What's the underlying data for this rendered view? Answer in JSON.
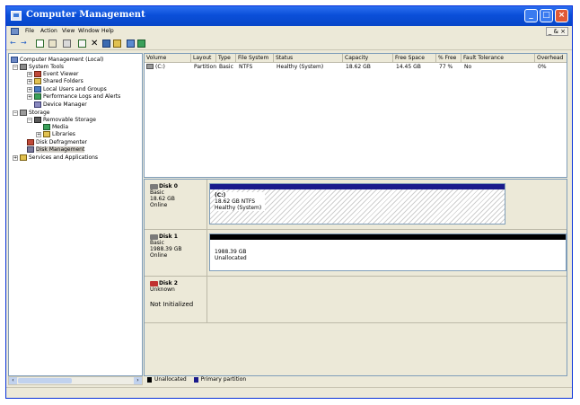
{
  "window": {
    "title": "Computer Management"
  },
  "menu": [
    {
      "label": "File"
    },
    {
      "label": "Action"
    },
    {
      "label": "View"
    },
    {
      "label": "Window"
    },
    {
      "label": "Help"
    }
  ],
  "mdi_controls": "_ & ×",
  "tree": [
    {
      "label": "Computer Management (Local)"
    },
    {
      "label": "System Tools"
    },
    {
      "label": "Event Viewer"
    },
    {
      "label": "Shared Folders"
    },
    {
      "label": "Local Users and Groups"
    },
    {
      "label": "Performance Logs and Alerts"
    },
    {
      "label": "Device Manager"
    },
    {
      "label": "Storage"
    },
    {
      "label": "Removable Storage"
    },
    {
      "label": "Media"
    },
    {
      "label": "Libraries"
    },
    {
      "label": "Disk Defragmenter"
    },
    {
      "label": "Disk Management"
    },
    {
      "label": "Services and Applications"
    }
  ],
  "volume_list": {
    "columns": [
      "Volume",
      "Layout",
      "Type",
      "File System",
      "Status",
      "Capacity",
      "Free Space",
      "% Free",
      "Fault Tolerance",
      "Overhead"
    ],
    "rows": [
      {
        "volume": "(C:)",
        "layout": "Partition",
        "type": "Basic",
        "fs": "NTFS",
        "status": "Healthy (System)",
        "capacity": "18.62 GB",
        "free": "14.45 GB",
        "pct": "77 %",
        "fault": "No",
        "overhead": "0%"
      }
    ]
  },
  "disks": [
    {
      "name": "Disk 0",
      "type": "Basic",
      "size": "18.62 GB",
      "state": "Online",
      "part_title": "(C:)",
      "part_line2": "18.62 GB NTFS",
      "part_line3": "Healthy (System)"
    },
    {
      "name": "Disk 1",
      "type": "Basic",
      "size": "1988.39 GB",
      "state": "Online",
      "part_line2": "1988.39 GB",
      "part_line3": "Unallocated"
    },
    {
      "name": "Disk 2",
      "type": "Unknown",
      "state": "Not Initialized"
    }
  ],
  "legend": [
    {
      "label": "Unallocated",
      "color": "#000000"
    },
    {
      "label": "Primary partition",
      "color": "#1a1a8c"
    }
  ],
  "colors": {
    "title_bar": "#0a4fd9",
    "primary_partition": "#1a1a8c",
    "unallocated": "#000000"
  }
}
